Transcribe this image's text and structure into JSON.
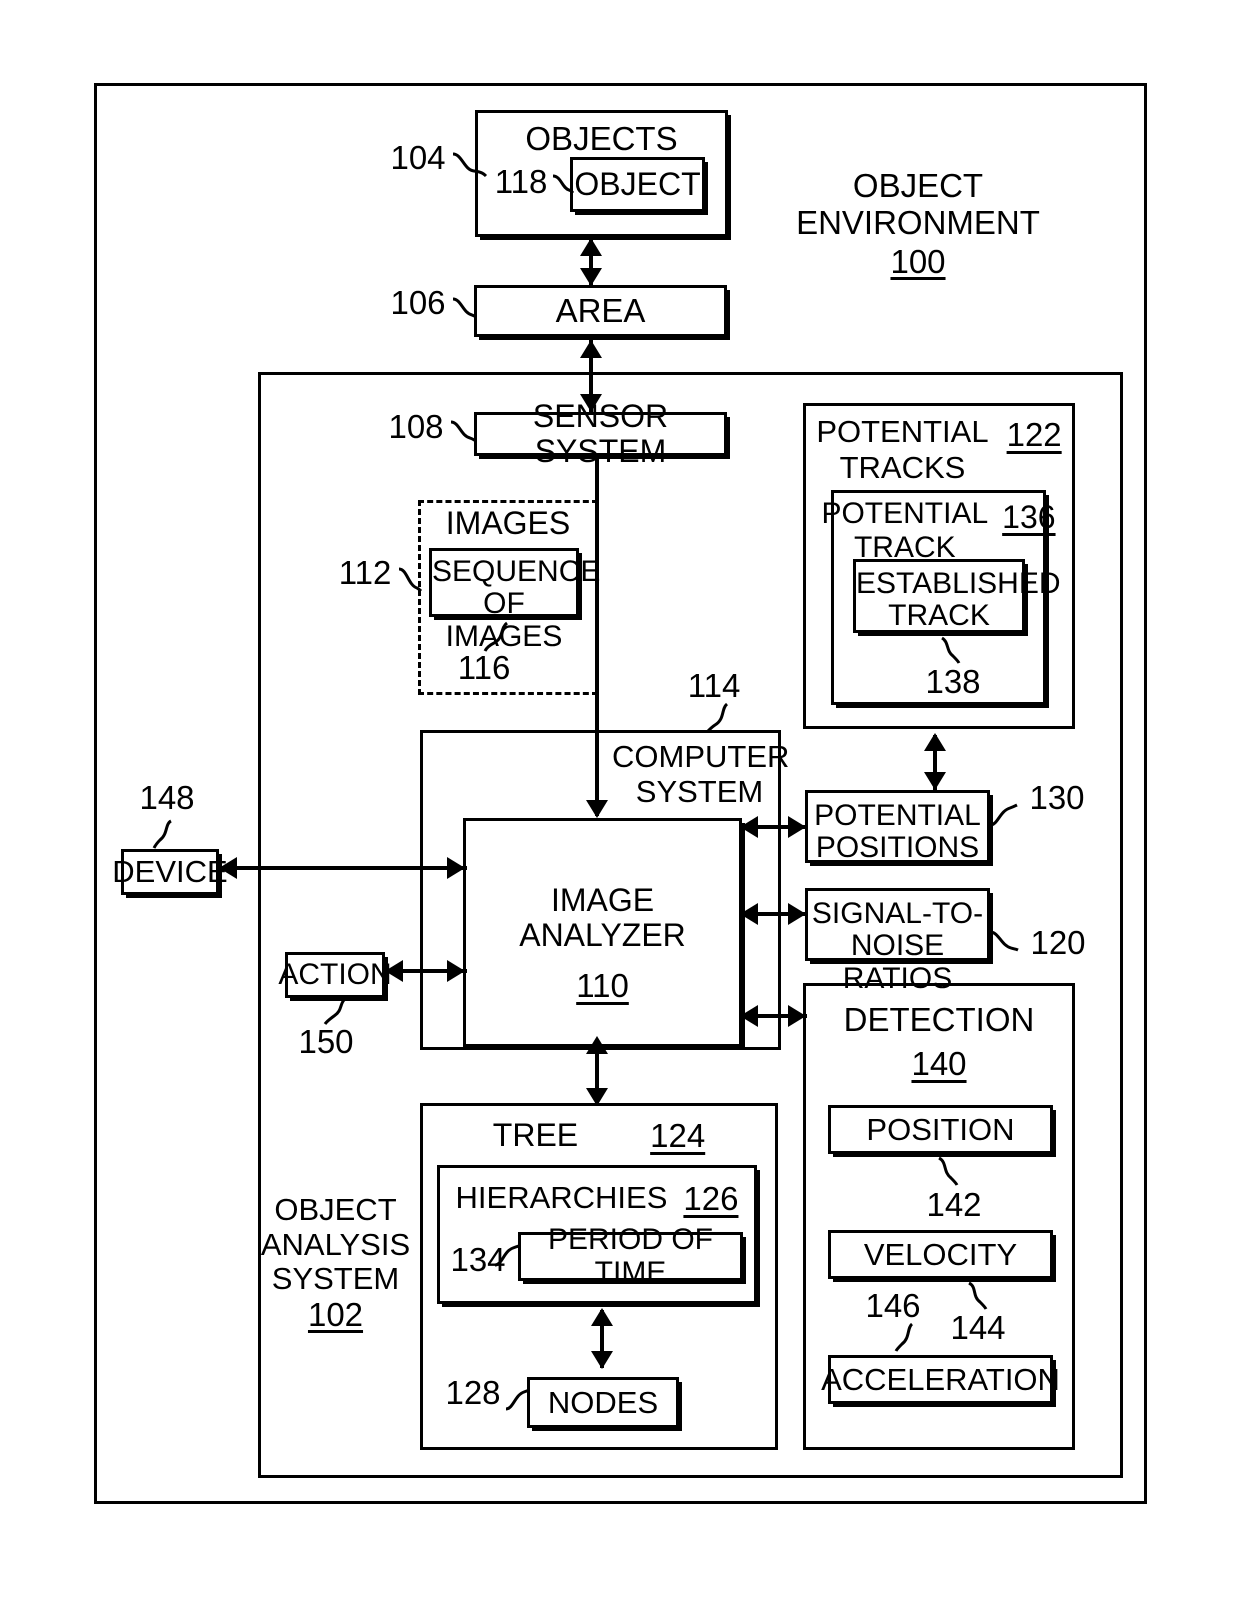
{
  "figure": {
    "environment_label": "OBJECT\nENVIRONMENT",
    "environment_ref": "100",
    "analysis_system_label": "OBJECT\nANALYSIS\nSYSTEM",
    "analysis_system_ref": "102"
  },
  "nodes": {
    "objects": {
      "label": "OBJECTS",
      "ref": "104"
    },
    "object": {
      "label": "OBJECT",
      "ref": "118"
    },
    "area": {
      "label": "AREA",
      "ref": "106"
    },
    "sensor_system": {
      "label": "SENSOR SYSTEM",
      "ref": "108"
    },
    "images": {
      "label": "IMAGES",
      "ref": "112"
    },
    "sequence_of_images": {
      "label": "SEQUENCE\nOF IMAGES",
      "ref": "116"
    },
    "computer_system": {
      "label": "COMPUTER\nSYSTEM",
      "ref": "114"
    },
    "image_analyzer": {
      "label": "IMAGE\nANALYZER",
      "ref": "110"
    },
    "potential_tracks": {
      "label": "POTENTIAL\nTRACKS",
      "ref": "122"
    },
    "potential_track": {
      "label": "POTENTIAL\nTRACK",
      "ref": "136"
    },
    "established_track": {
      "label": "ESTABLISHED\nTRACK",
      "ref": "138"
    },
    "potential_positions": {
      "label": "POTENTIAL\nPOSITIONS",
      "ref": "130"
    },
    "signal_to_noise_ratios": {
      "label": "SIGNAL-TO-\nNOISE RATIOS",
      "ref": "120"
    },
    "detection": {
      "label": "DETECTION",
      "ref": "140"
    },
    "position": {
      "label": "POSITION",
      "ref": "142"
    },
    "velocity": {
      "label": "VELOCITY",
      "ref": "144"
    },
    "acceleration": {
      "label": "ACCELERATION",
      "ref": "146"
    },
    "tree": {
      "label": "TREE",
      "ref": "124"
    },
    "hierarchies": {
      "label": "HIERARCHIES",
      "ref": "126"
    },
    "period_of_time": {
      "label": "PERIOD OF TIME",
      "ref": "134"
    },
    "nodes_box": {
      "label": "NODES",
      "ref": "128"
    },
    "device": {
      "label": "DEVICE",
      "ref": "148"
    },
    "action": {
      "label": "ACTION",
      "ref": "150"
    }
  }
}
